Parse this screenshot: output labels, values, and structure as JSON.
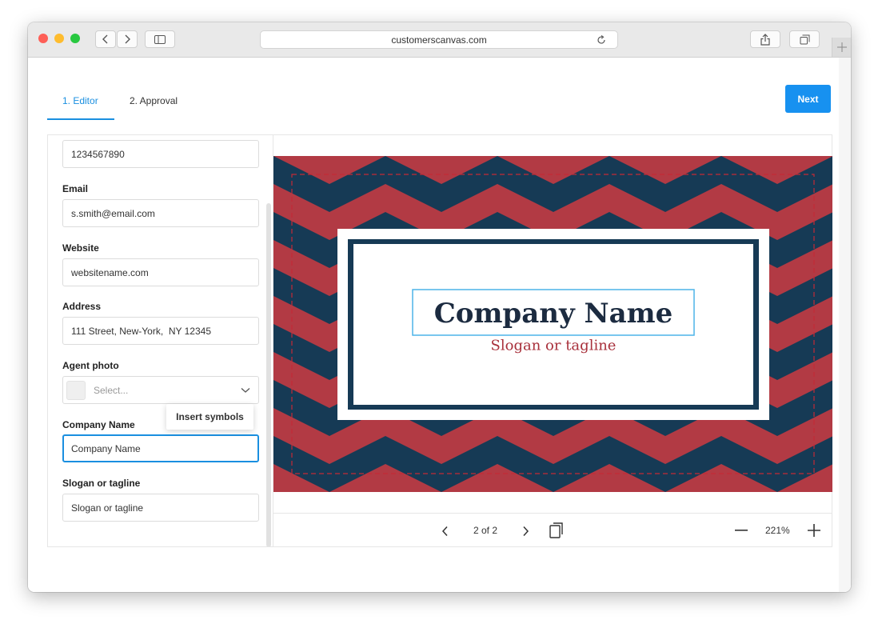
{
  "browser": {
    "url": "customerscanvas.com"
  },
  "tabs": [
    {
      "label": "1. Editor",
      "active": true
    },
    {
      "label": "2. Approval",
      "active": false
    }
  ],
  "next_label": "Next",
  "form": {
    "phone_value": "1234567890",
    "email_label": "Email",
    "email_value": "s.smith@email.com",
    "website_label": "Website",
    "website_value": "websitename.com",
    "address_label": "Address",
    "address_value": "111 Street, New-York,  NY 12345",
    "agent_photo_label": "Agent photo",
    "agent_photo_placeholder": "Select...",
    "company_label": "Company Name",
    "company_value": "Company Name",
    "slogan_label": "Slogan or tagline",
    "slogan_value": "Slogan or tagline",
    "insert_symbols": "Insert symbols"
  },
  "design": {
    "company_name": "Company Name",
    "slogan": "Slogan or tagline",
    "colors": {
      "red": "#b23a44",
      "navy": "#163a55",
      "selection": "#4db4e8"
    }
  },
  "pager": {
    "page": "2 of 2",
    "zoom": "221%"
  },
  "icons": [
    "back-icon",
    "forward-icon",
    "sidebar-icon",
    "reload-icon",
    "share-icon",
    "tabs-icon",
    "plus-icon",
    "chevron-down-icon",
    "pages-icon",
    "zoom-out-icon",
    "zoom-in-icon"
  ]
}
